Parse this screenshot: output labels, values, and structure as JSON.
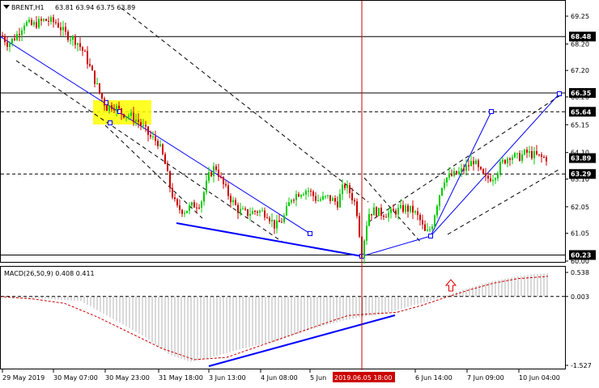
{
  "header": {
    "icon": "triangle-down-icon",
    "symbol_label": "BRENT,H1",
    "ohlc": "63.81 63.94 63.75 63.89"
  },
  "macd_header": "MACD(26,50,9) 0.408 0.411",
  "colors": {
    "bull": "#00cc00",
    "bear": "#cc0000",
    "channel": "#0000ff",
    "dashed": "#000000",
    "highlight": "#ffff00",
    "crosshair": "#cc0000",
    "macd_hist": "#b4b4b4",
    "macd_signal": "#cc0000",
    "price_label_bg": "#000000"
  },
  "price_axis_labels": [
    "69.25",
    "68.20",
    "67.20",
    "66.20",
    "65.15",
    "64.10",
    "63.10",
    "62.05",
    "61.05",
    "60.00"
  ],
  "price_levels": [
    {
      "value": "68.48",
      "line": "solid"
    },
    {
      "value": "66.35",
      "line": "solid"
    },
    {
      "value": "65.64",
      "line": "dashed"
    },
    {
      "value": "63.89",
      "line": "none"
    },
    {
      "value": "63.29",
      "line": "dashed"
    },
    {
      "value": "60.23",
      "line": "solid"
    }
  ],
  "macd_axis_labels": [
    "0.538",
    "0.003",
    "-1.527"
  ],
  "time_axis_labels": [
    "29 May 2019",
    "30 May 07:00",
    "30 May 23:00",
    "31 May 18:00",
    "3 Jun 13:00",
    "4 Jun 08:00",
    "5 Jun",
    "6 Jun 14:00",
    "7 Jun 09:00",
    "10 Jun 04:00"
  ],
  "crosshair_time": "2019.06.05 18:00",
  "arrow_icon": "up-arrow-icon",
  "chart_data": {
    "type": "candlestick",
    "symbol": "BRENT",
    "timeframe": "H1",
    "ylim": [
      60.0,
      69.6
    ],
    "close_path": [
      [
        0,
        68.6
      ],
      [
        10,
        68.2
      ],
      [
        20,
        68.5
      ],
      [
        30,
        69.0
      ],
      [
        40,
        68.9
      ],
      [
        55,
        69.1
      ],
      [
        70,
        69.0
      ],
      [
        80,
        68.6
      ],
      [
        95,
        68.3
      ],
      [
        105,
        67.8
      ],
      [
        115,
        67.0
      ],
      [
        125,
        66.2
      ],
      [
        132,
        65.8
      ],
      [
        140,
        65.9
      ],
      [
        150,
        65.6
      ],
      [
        160,
        65.5
      ],
      [
        170,
        65.3
      ],
      [
        178,
        65.0
      ],
      [
        185,
        64.7
      ],
      [
        195,
        64.5
      ],
      [
        203,
        63.8
      ],
      [
        210,
        62.8
      ],
      [
        218,
        62.0
      ],
      [
        228,
        61.9
      ],
      [
        238,
        62.1
      ],
      [
        248,
        62.2
      ],
      [
        258,
        63.2
      ],
      [
        266,
        63.6
      ],
      [
        274,
        63.0
      ],
      [
        284,
        62.4
      ],
      [
        295,
        61.9
      ],
      [
        305,
        61.8
      ],
      [
        318,
        61.9
      ],
      [
        330,
        61.8
      ],
      [
        340,
        61.3
      ],
      [
        350,
        61.6
      ],
      [
        360,
        62.4
      ],
      [
        370,
        62.6
      ],
      [
        380,
        62.7
      ],
      [
        392,
        62.3
      ],
      [
        405,
        62.4
      ],
      [
        417,
        62.2
      ],
      [
        425,
        62.9
      ],
      [
        432,
        62.6
      ],
      [
        440,
        62.1
      ],
      [
        447,
        60.3
      ],
      [
        455,
        61.8
      ],
      [
        462,
        61.9
      ],
      [
        472,
        61.8
      ],
      [
        482,
        61.8
      ],
      [
        490,
        61.9
      ],
      [
        500,
        62.0
      ],
      [
        510,
        61.9
      ],
      [
        518,
        61.6
      ],
      [
        526,
        61.0
      ],
      [
        533,
        61.3
      ],
      [
        540,
        62.2
      ],
      [
        548,
        63.1
      ],
      [
        556,
        63.2
      ],
      [
        565,
        63.3
      ],
      [
        575,
        63.5
      ],
      [
        585,
        63.8
      ],
      [
        592,
        63.4
      ],
      [
        600,
        63.1
      ],
      [
        610,
        63.2
      ],
      [
        620,
        63.7
      ],
      [
        630,
        64.0
      ],
      [
        640,
        63.9
      ],
      [
        650,
        64.1
      ],
      [
        660,
        64.0
      ],
      [
        670,
        63.9
      ],
      [
        677,
        63.89
      ]
    ],
    "macd_ylim": [
      -1.6,
      0.6
    ],
    "macd_histogram_path": [
      [
        0,
        0.0
      ],
      [
        60,
        -0.05
      ],
      [
        100,
        -0.1
      ],
      [
        140,
        -0.5
      ],
      [
        180,
        -0.9
      ],
      [
        210,
        -1.3
      ],
      [
        235,
        -1.45
      ],
      [
        260,
        -1.35
      ],
      [
        300,
        -1.15
      ],
      [
        340,
        -1.0
      ],
      [
        380,
        -0.75
      ],
      [
        420,
        -0.55
      ],
      [
        447,
        -0.45
      ],
      [
        470,
        -0.4
      ],
      [
        500,
        -0.25
      ],
      [
        530,
        -0.1
      ],
      [
        555,
        0.05
      ],
      [
        580,
        0.2
      ],
      [
        610,
        0.35
      ],
      [
        640,
        0.45
      ],
      [
        660,
        0.5
      ],
      [
        677,
        0.52
      ]
    ],
    "macd_signal_path": [
      [
        0,
        0.0
      ],
      [
        40,
        -0.05
      ],
      [
        80,
        -0.15
      ],
      [
        120,
        -0.45
      ],
      [
        160,
        -0.8
      ],
      [
        200,
        -1.15
      ],
      [
        240,
        -1.4
      ],
      [
        280,
        -1.35
      ],
      [
        320,
        -1.1
      ],
      [
        360,
        -0.85
      ],
      [
        400,
        -0.6
      ],
      [
        430,
        -0.42
      ],
      [
        460,
        -0.38
      ],
      [
        490,
        -0.35
      ],
      [
        520,
        -0.2
      ],
      [
        550,
        -0.02
      ],
      [
        580,
        0.15
      ],
      [
        610,
        0.3
      ],
      [
        640,
        0.4
      ],
      [
        677,
        0.45
      ]
    ]
  }
}
